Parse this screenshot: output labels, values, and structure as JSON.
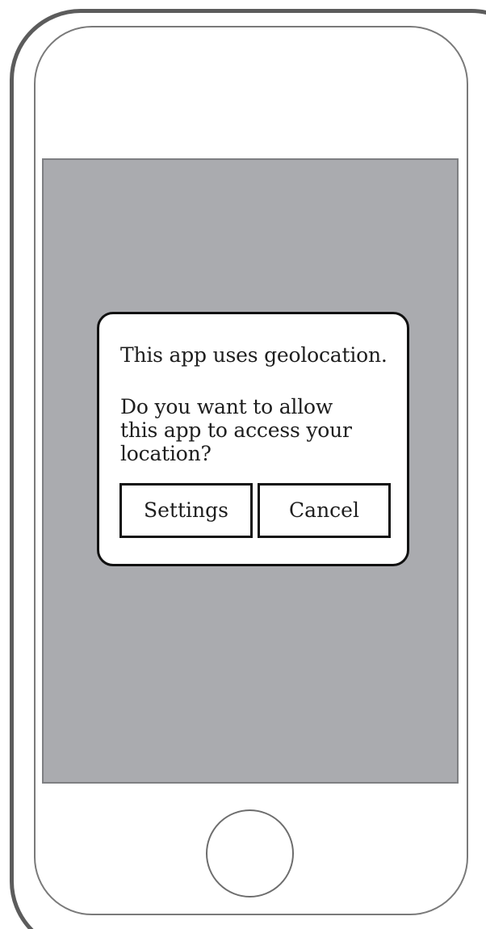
{
  "dialog": {
    "title": "This app uses geolocation.",
    "message": "Do you want to allow this app to access your location?",
    "buttons": {
      "settings": "Settings",
      "cancel": "Cancel"
    }
  },
  "colors": {
    "screen_background": "#aaabaf",
    "dialog_background": "#ffffff",
    "dialog_border": "#111111",
    "phone_outline": "#5c5c5c"
  }
}
